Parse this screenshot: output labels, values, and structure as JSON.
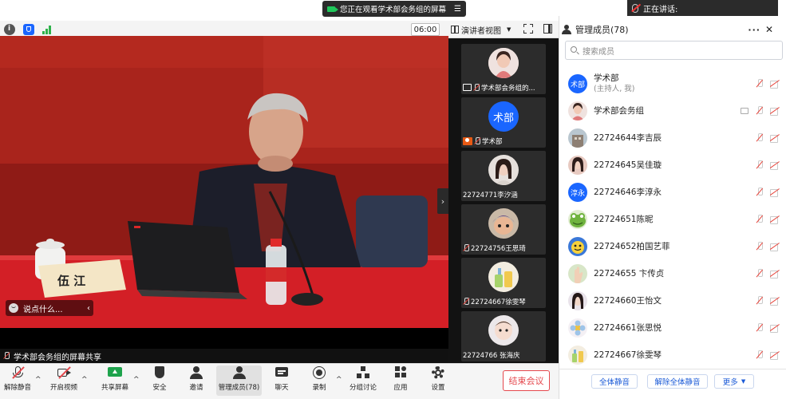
{
  "banner": {
    "text": "您正在观看学术部会务组的屏幕",
    "menu_icon": "menu-icon"
  },
  "speaking": {
    "label": "正在讲话:"
  },
  "toolbar": {
    "timer": "06:00",
    "view_label": "演讲者视图"
  },
  "stage": {
    "nameplate": "伍 江",
    "chat_placeholder": "说点什么...",
    "share_label": "学术部会务组的屏幕共享"
  },
  "thumbnails": [
    {
      "name": "学术部会务组的...",
      "badge": "share",
      "avatar": "photo-woman"
    },
    {
      "name": "学术部",
      "badge": "host",
      "avatar_text": "术部",
      "avatar_color": "#1a66ff"
    },
    {
      "name": "22724771李汐涵",
      "badge": "none",
      "avatar": "photo-girl"
    },
    {
      "name": "22724756王思琦",
      "badge": "mic-off",
      "avatar": "photo-child"
    },
    {
      "name": "22724667徐雯琴",
      "badge": "mic-off",
      "avatar": "photo-drink"
    },
    {
      "name": "22724766 张海庆",
      "badge": "none",
      "avatar": "photo-baby"
    }
  ],
  "tools": [
    {
      "label": "解除静音",
      "icon": "mic-muted-icon"
    },
    {
      "label": "开启视频",
      "icon": "video-off-icon"
    },
    {
      "label": "共享屏幕",
      "icon": "share-screen-icon"
    },
    {
      "label": "安全",
      "icon": "shield-icon"
    },
    {
      "label": "邀请",
      "icon": "invite-icon"
    },
    {
      "label": "管理成员(78)",
      "icon": "members-icon"
    },
    {
      "label": "聊天",
      "icon": "chat-icon"
    },
    {
      "label": "录制",
      "icon": "record-icon"
    },
    {
      "label": "分组讨论",
      "icon": "breakout-icon"
    },
    {
      "label": "应用",
      "icon": "apps-icon"
    },
    {
      "label": "设置",
      "icon": "settings-icon"
    }
  ],
  "end_meeting": "结束会议",
  "panel": {
    "title": "管理成员(78)",
    "search_placeholder": "搜索成员",
    "members": [
      {
        "name": "学术部",
        "sub": "(主持人, 我)",
        "avatar_text": "术部",
        "avatar_color": "#1a66ff"
      },
      {
        "name": "学术部会务组",
        "avatar": "photo-woman",
        "sharing": true
      },
      {
        "name": "22724644李吉辰",
        "avatar": "photo-building"
      },
      {
        "name": "22724645吴佳璇",
        "avatar": "photo-woman2"
      },
      {
        "name": "22724646李淳永",
        "avatar_text": "淳永",
        "avatar_color": "#1a66ff"
      },
      {
        "name": "22724651陈昵",
        "avatar": "photo-frog"
      },
      {
        "name": "22724652柏国艺菲",
        "avatar": "photo-cartoon"
      },
      {
        "name": "22724655 卞传贞",
        "avatar": "photo-hand"
      },
      {
        "name": "22724660王怡文",
        "avatar": "photo-girl2"
      },
      {
        "name": "22724661张思悦",
        "avatar": "photo-flower"
      },
      {
        "name": "22724667徐雯琴",
        "avatar": "photo-drink"
      }
    ],
    "mute_all": "全体静音",
    "unmute_all": "解除全体静音",
    "more": "更多"
  }
}
